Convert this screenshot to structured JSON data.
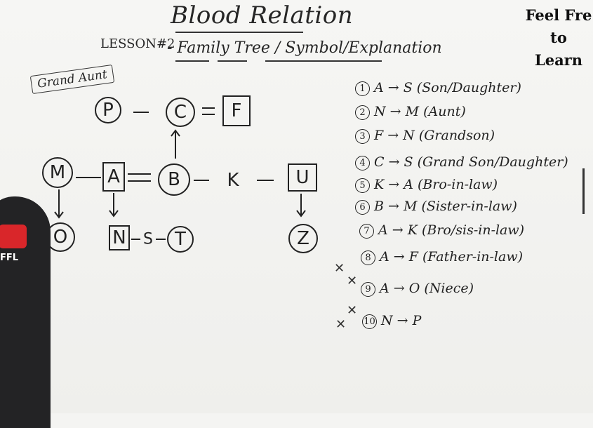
{
  "title": "Blood Relation",
  "lesson": "LESSON#2",
  "subtitle": "- Family Tree / Symbol/Explanation",
  "grand_aunt_label": "Grand Aunt",
  "corner_note": [
    "Feel Fre",
    "to",
    "Learn"
  ],
  "logo_text": "FFL",
  "tree": {
    "nodes": {
      "P": "P",
      "C": "C",
      "F": "F",
      "M": "M",
      "A": "A",
      "B": "B",
      "K": "K",
      "U": "U",
      "O": "O",
      "N": "N",
      "S": "S",
      "T": "T",
      "Z": "Z"
    },
    "links": {
      "dash": "—",
      "married": "⇌"
    }
  },
  "relations": [
    {
      "num": "1",
      "text": "A → S (Son/Daughter)"
    },
    {
      "num": "2",
      "text": "N → M (Aunt)"
    },
    {
      "num": "3",
      "text": "F → N (Grandson)"
    },
    {
      "num": "4",
      "text": "C → S (Grand Son/Daughter)"
    },
    {
      "num": "5",
      "text": "K → A (Bro-in-law)"
    },
    {
      "num": "6",
      "text": "B → M (Sister-in-law)"
    },
    {
      "num": "7",
      "text": "A → K (Bro/sis-in-law)"
    },
    {
      "num": "8",
      "text": "A → F (Father-in-law)"
    },
    {
      "num": "9",
      "text": "A → O (Niece)"
    },
    {
      "num": "10",
      "text": "N → P"
    }
  ]
}
